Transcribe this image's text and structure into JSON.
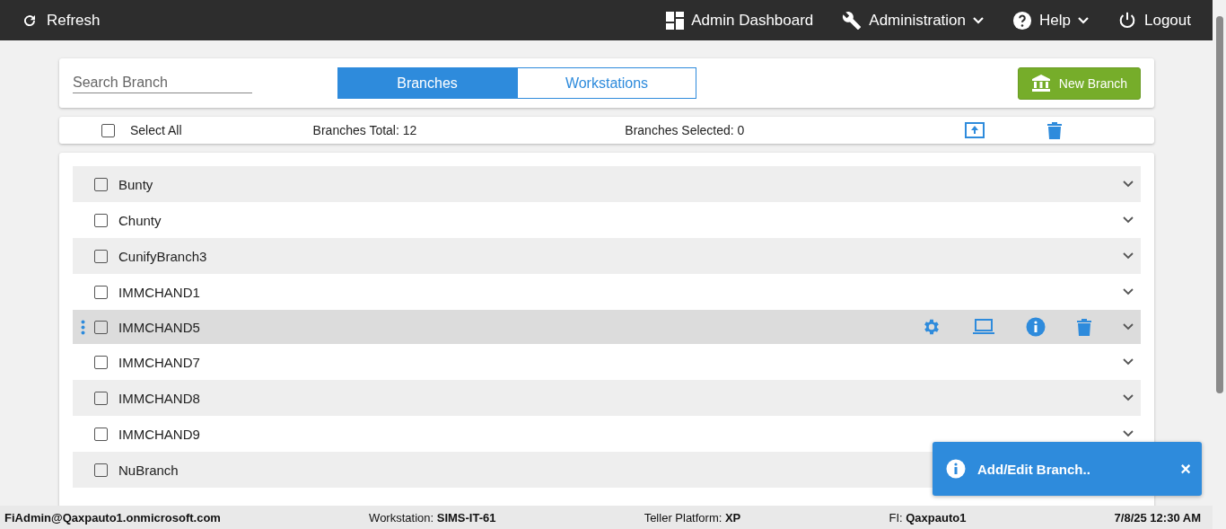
{
  "navbar": {
    "refresh": "Refresh",
    "items": [
      {
        "label": "Admin Dashboard",
        "dropdown": false
      },
      {
        "label": "Administration",
        "dropdown": true
      },
      {
        "label": "Help",
        "dropdown": true
      },
      {
        "label": "Logout",
        "dropdown": false
      }
    ]
  },
  "search": {
    "placeholder": "Search Branch"
  },
  "tabs": [
    {
      "label": "Branches",
      "selected": true
    },
    {
      "label": "Workstations",
      "selected": false
    }
  ],
  "new_button": "New Branch",
  "summary": {
    "select_all": "Select All",
    "checked": false,
    "total": "Branches Total: 12",
    "selected_count": "Branches Selected: 0"
  },
  "branches": [
    {
      "name": "Bunty",
      "checked": false,
      "active": false
    },
    {
      "name": "Chunty",
      "checked": false,
      "active": false
    },
    {
      "name": "CunifyBranch3",
      "checked": false,
      "active": false
    },
    {
      "name": "IMMCHAND1",
      "checked": false,
      "active": false
    },
    {
      "name": "IMMCHAND5",
      "checked": false,
      "active": true
    },
    {
      "name": "IMMCHAND7",
      "checked": false,
      "active": false
    },
    {
      "name": "IMMCHAND8",
      "checked": false,
      "active": false
    },
    {
      "name": "IMMCHAND9",
      "checked": false,
      "active": false
    },
    {
      "name": "NuBranch",
      "checked": false,
      "active": false
    }
  ],
  "toast": {
    "message": "Add/Edit Branch..",
    "close": "×"
  },
  "status_bar": {
    "user": "FiAdmin@Qaxpauto1.onmicrosoft.com",
    "workstation": "Workstation: **SIMS-IT-61**",
    "platform": "Teller Platform: **XP**",
    "fi": "FI: **Qaxpauto1**",
    "datetime": "7/8/25 12:30 AM"
  }
}
